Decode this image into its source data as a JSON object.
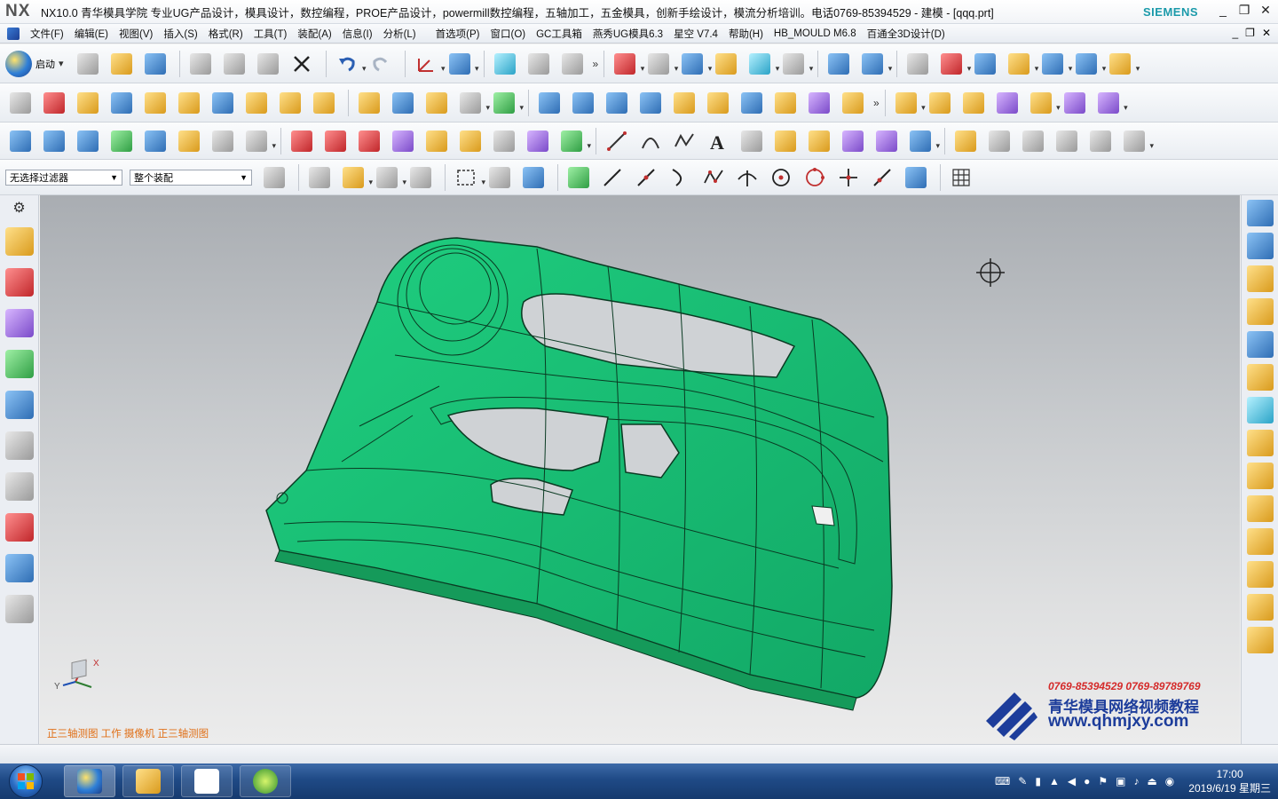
{
  "window": {
    "logo": "NX",
    "title": "NX10.0 青华模具学院 专业UG产品设计，模具设计，数控编程，PROE产品设计，powermill数控编程，五轴加工，五金模具，创新手绘设计，模流分析培训。电话0769-85394529 - 建模 - [qqq.prt]",
    "brand": "SIEMENS",
    "controls": [
      "_",
      "❐",
      "✕"
    ]
  },
  "menu": {
    "items": [
      "文件(F)",
      "编辑(E)",
      "视图(V)",
      "插入(S)",
      "格式(R)",
      "工具(T)",
      "装配(A)",
      "信息(I)",
      "分析(L)"
    ],
    "items2": [
      "首选项(P)",
      "窗口(O)",
      "GC工具箱",
      "燕秀UG模具6.3",
      "星空 V7.4",
      "帮助(H)",
      "HB_MOULD M6.8",
      "百通全3D设计(D)"
    ],
    "controls": [
      "_",
      "❐",
      "✕"
    ]
  },
  "toolbar": {
    "start_label": "启动",
    "more": "»",
    "filter_select": "无选择过滤器",
    "assembly_select": "整个装配"
  },
  "viewport": {
    "status_text": "正三轴测图  工作  摄像机  正三轴测图",
    "triad_x": "X",
    "triad_y": "Y",
    "part_color": "#1fcf80",
    "edge_color": "#0a3a22"
  },
  "watermark": {
    "phones": "0769-85394529  0769-89789769",
    "name": "青华模具网络视频教程",
    "site": "www.qhmjxy.com"
  },
  "taskbar": {
    "time": "17:00",
    "date": "2019/6/19 星期三"
  }
}
